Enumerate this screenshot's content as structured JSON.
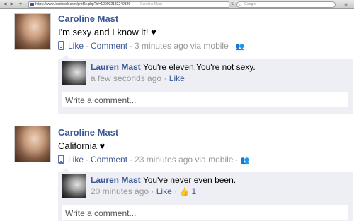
{
  "browser": {
    "back_icon": "◀",
    "forward_icon": "▶",
    "add_icon": "+",
    "url": "https://www.facebook.com/profile.php?id=100002182240326",
    "page_title": "— Caroline Mast",
    "reload_icon": "↻",
    "search_icon": "⌕",
    "search_placeholder": "Google",
    "menu_icon": "≡"
  },
  "posts": [
    {
      "author": "Caroline Mast",
      "message": "I'm sexy and I know it! ♥",
      "like": "Like",
      "sep1": "·",
      "comment": "Comment",
      "sep2": "·",
      "time": "3 minutes ago via mobile",
      "sep3": "·",
      "audience_icon": "👥",
      "reply": {
        "author": "Lauren Mast",
        "text": "You're eleven.You're not sexy.",
        "time": "a few seconds ago",
        "sep": "·",
        "like": "Like",
        "likes_count": ""
      },
      "write_placeholder": "Write a comment..."
    },
    {
      "author": "Caroline Mast",
      "message": "California ♥",
      "like": "Like",
      "sep1": "·",
      "comment": "Comment",
      "sep2": "·",
      "time": "23 minutes ago via mobile",
      "sep3": "·",
      "audience_icon": "👥",
      "reply": {
        "author": "Lauren Mast",
        "text": "You've never even been.",
        "time": "20 minutes ago",
        "sep": "·",
        "like": "Like",
        "sep2": "·",
        "thumb_icon": "👍",
        "likes_count": "1"
      },
      "write_placeholder": "Write a comment..."
    }
  ]
}
